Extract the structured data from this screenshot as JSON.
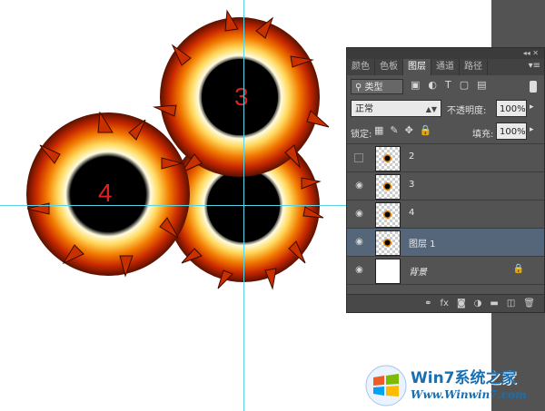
{
  "canvas": {
    "suns": [
      {
        "label": "3"
      },
      {
        "label": "4"
      },
      {
        "label": ""
      }
    ]
  },
  "panel": {
    "tabs": [
      "颜色",
      "色板",
      "图层",
      "通道",
      "路径"
    ],
    "active_tab": "图层",
    "filter_label": "类型",
    "blend_mode": "正常",
    "opacity_label": "不透明度:",
    "opacity_value": "100%",
    "lock_label": "锁定:",
    "fill_label": "填充:",
    "fill_value": "100%",
    "layers": [
      {
        "name": "2",
        "visible": false,
        "selected": false
      },
      {
        "name": "3",
        "visible": true,
        "selected": false
      },
      {
        "name": "4",
        "visible": true,
        "selected": false
      },
      {
        "name": "图层 1",
        "visible": true,
        "selected": true
      },
      {
        "name": "背景",
        "visible": true,
        "selected": false,
        "locked": true
      }
    ]
  },
  "icons": {
    "eye": "eye-icon",
    "lock": "lock-icon",
    "link": "link-icon",
    "fx": "fx-icon",
    "mask": "mask-icon",
    "adjust": "adjustment-icon",
    "folder": "folder-icon",
    "new": "new-layer-icon",
    "trash": "trash-icon"
  },
  "watermark": {
    "title": "Win7系统之家",
    "url": "Www.Winwin7.com"
  },
  "colors": {
    "guide": "#5fd3e6",
    "panel_bg": "#535353",
    "selected_layer": "#56667a",
    "label_red": "#e02020"
  }
}
